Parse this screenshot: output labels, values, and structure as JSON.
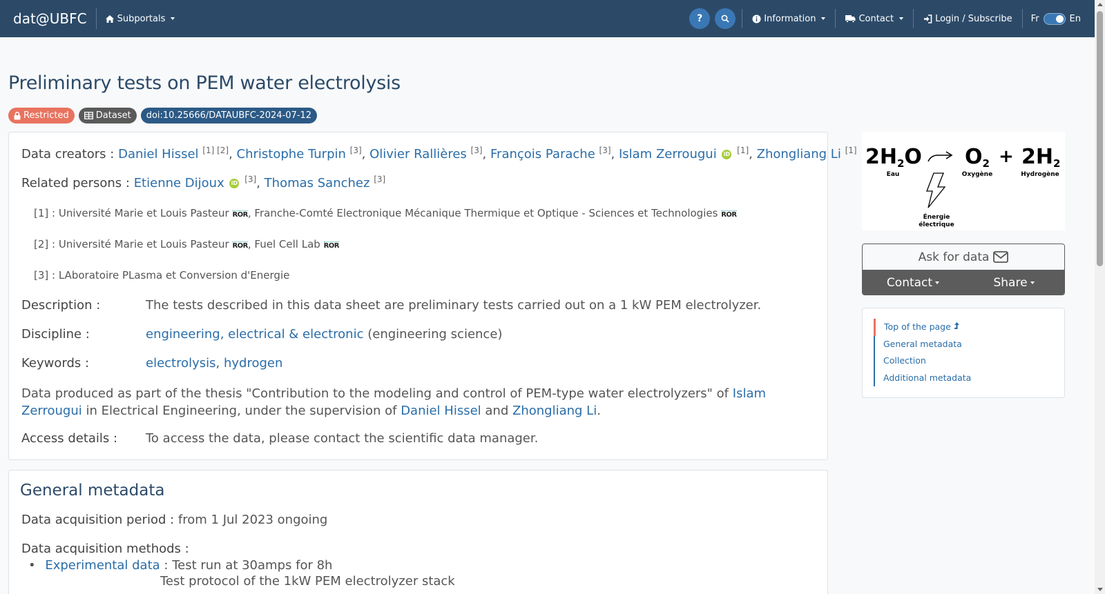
{
  "navbar": {
    "brand": "dat@UBFC",
    "subportals": "Subportals",
    "help": "?",
    "information": "Information",
    "contact": "Contact",
    "login": "Login / Subscribe",
    "lang_fr": "Fr",
    "lang_en": "En"
  },
  "page": {
    "title": "Preliminary tests on PEM water electrolysis",
    "badges": {
      "restricted": "Restricted",
      "dataset": "Dataset",
      "doi": "doi:10.25666/DATAUBFC-2024-07-12"
    }
  },
  "creators": {
    "label": "Data creators :",
    "people": [
      {
        "name": "Daniel Hissel",
        "refs": "[1] [2]"
      },
      {
        "name": "Christophe Turpin",
        "refs": "[3]"
      },
      {
        "name": "Olivier Rallières",
        "refs": "[3]"
      },
      {
        "name": "François Parache",
        "refs": "[3]"
      },
      {
        "name": "Islam Zerrougui",
        "refs": "[1]"
      },
      {
        "name": "Zhongliang Li",
        "refs": "[1]"
      }
    ]
  },
  "related": {
    "label": "Related persons :",
    "people": [
      {
        "name": "Etienne Dijoux",
        "refs": "[3]"
      },
      {
        "name": "Thomas Sanchez",
        "refs": "[3]"
      }
    ]
  },
  "affiliations": [
    {
      "num": "[1] :",
      "a": "Université Marie et Louis Pasteur",
      "b": "Franche-Comté Electronique Mécanique Thermique et Optique - Sciences et Technologies"
    },
    {
      "num": "[2] :",
      "a": "Université Marie et Louis Pasteur",
      "b": "Fuel Cell Lab"
    },
    {
      "num": "[3] :",
      "a": "LAboratoire PLasma et Conversion d'Energie"
    }
  ],
  "ror_label": "ROR",
  "orcid_label": "iD",
  "description": {
    "label": "Description :",
    "value": "The tests described in this data sheet are preliminary tests carried out on a 1 kW PEM electrolyzer."
  },
  "discipline": {
    "label": "Discipline :",
    "link": "engineering, electrical & electronic",
    "extra": "(engineering science)"
  },
  "keywords": {
    "label": "Keywords :",
    "items": [
      "electrolysis",
      "hydrogen"
    ]
  },
  "thesis": {
    "p1": "Data produced as part of the thesis \"Contribution to the modeling and control of PEM-type water electrolyzers\" of",
    "author": "Islam Zerrougui",
    "p2": "in",
    "p3": "Electrical Engineering, under the supervision of",
    "sup1": "Daniel Hissel",
    "and": "and",
    "sup2": "Zhongliang Li"
  },
  "access": {
    "label": "Access details :",
    "value": "To access the data, please contact the scientific data manager."
  },
  "general": {
    "title": "General metadata",
    "period_label": "Data acquisition period :",
    "period_value": "from 1 Jul 2023 ongoing",
    "methods_label": "Data acquisition methods :",
    "method_link": "Experimental data",
    "method_value": ": Test run at 30amps for 8h",
    "method_value2": "Test protocol of the 1kW PEM electrolyzer stack"
  },
  "diagram": {
    "water": "2H",
    "water_sub": "2",
    "water_o": "O",
    "o2": "O",
    "o2_sub": "2",
    "plus": "+",
    "h2": "2H",
    "h2_sub": "2",
    "eau": "Eau",
    "oxygene": "Oxygène",
    "hydrogene": "Hydrogène",
    "energie1": "Énergie",
    "energie2": "électrique"
  },
  "sidebar": {
    "ask": "Ask for data",
    "contact": "Contact",
    "share": "Share"
  },
  "toc": [
    "Top of the page",
    "General metadata",
    "Collection",
    "Additional metadata"
  ]
}
